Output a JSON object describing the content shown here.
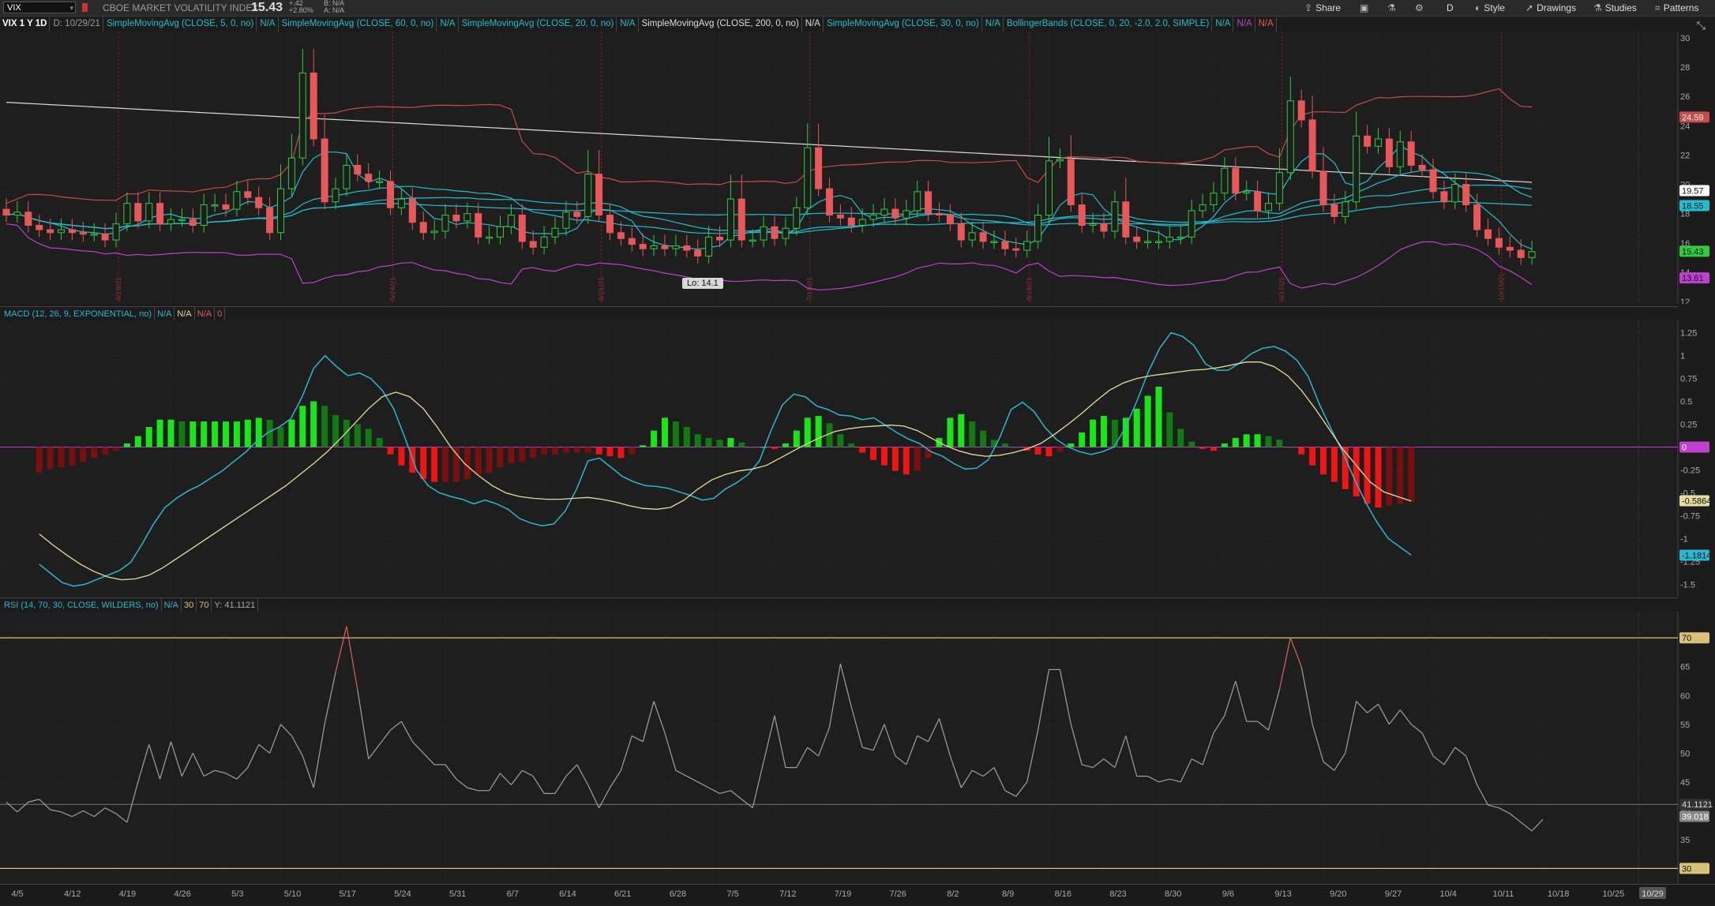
{
  "header": {
    "symbol": "VIX",
    "company": "CBOE MARKET VOLATILITY INDEX",
    "last": "15.43",
    "change": "+.42",
    "change_pct": "+2.80%",
    "bid": "B: N/A",
    "ask": "A: N/A",
    "buttons": {
      "share": "Share",
      "d": "D",
      "style": "Style",
      "drawings": "Drawings",
      "studies": "Studies",
      "patterns": "Patterns"
    }
  },
  "price_panel": {
    "title": "VIX 1 Y 1D",
    "date": "D: 10/29/21",
    "studies": [
      {
        "label": "SimpleMovingAvg (CLOSE, 5, 0, no)",
        "value": "N/A"
      },
      {
        "label": "SimpleMovingAvg (CLOSE, 60, 0, no)",
        "value": "N/A"
      },
      {
        "label": "SimpleMovingAvg (CLOSE, 20, 0, no)",
        "value": "N/A"
      },
      {
        "label": "SimpleMovingAvg (CLOSE, 200, 0, no)",
        "value": "N/A"
      },
      {
        "label": "SimpleMovingAvg (CLOSE, 30, 0, no)",
        "value": "N/A"
      },
      {
        "label": "BollingerBands (CLOSE, 0, 20, -2.0, 2.0, SIMPLE)",
        "value": "N/A",
        "value2": "N/A",
        "value3": "N/A"
      }
    ],
    "lo_label": "Lo: 14.1",
    "y_ticks": [
      "30",
      "28",
      "26",
      "24",
      "22",
      "20",
      "18",
      "16",
      "14",
      "12"
    ],
    "badges": [
      "24.59",
      "19.57",
      "18.55",
      "15.43",
      "13.61"
    ],
    "vlines": [
      "4/19/21",
      "5/24/21",
      "6/21/21",
      "7/19/21",
      "8/16/21",
      "9/17/21",
      "10/15/21"
    ]
  },
  "macd_panel": {
    "label": "MACD (12, 26, 9, EXPONENTIAL, no)",
    "v1": "N/A",
    "v2": "N/A",
    "v3": "N/A",
    "v4": "0",
    "y_ticks": [
      "1.25",
      "1",
      "0.75",
      "0.5",
      "0.25",
      "0",
      "-0.25",
      "-0.5",
      "-0.75",
      "-1",
      "-1.25",
      "-1.5"
    ],
    "badges": [
      "0",
      "-0.5864",
      "-1.1814"
    ]
  },
  "rsi_panel": {
    "label": "RSI (14, 70, 30, CLOSE, WILDERS, no)",
    "v1": "N/A",
    "ob": "30",
    "os": "70",
    "y": "Y: 41.1121",
    "y_ticks": [
      "70",
      "65",
      "60",
      "55",
      "50",
      "45",
      "40",
      "35",
      "30"
    ],
    "badges": [
      "70",
      "41.1121",
      "39.018",
      "30"
    ]
  },
  "x_axis": {
    "ticks": [
      "4/5",
      "4/12",
      "4/19",
      "4/26",
      "5/3",
      "5/10",
      "5/17",
      "5/24",
      "5/31",
      "6/7",
      "6/14",
      "6/21",
      "6/28",
      "7/5",
      "7/12",
      "7/19",
      "7/26",
      "8/2",
      "8/9",
      "8/16",
      "8/23",
      "8/30",
      "9/6",
      "9/13",
      "9/20",
      "9/27",
      "10/4",
      "10/11",
      "10/18",
      "10/25"
    ],
    "last_date_badge": "10/29"
  },
  "colors": {
    "up": "#2ecc40",
    "down": "#e8585a",
    "sma": "#1fbfcf",
    "sma200": "#dcdcdc",
    "bb_upper": "#c84a4a",
    "bb_lower": "#c040d0",
    "macd": "#2ab8d0",
    "signal": "#e6dca0",
    "rsi": "#a0a0a0",
    "rsi_ob": "#d8c27a",
    "rsi_over": "#e06060"
  },
  "chart_data": [
    {
      "type": "candlestick",
      "title": "VIX 1 Y 1D",
      "ylim": [
        12,
        30
      ],
      "x": [
        "4/5",
        "4/6",
        "4/7",
        "4/8",
        "4/9",
        "4/12",
        "4/13",
        "4/14",
        "4/15",
        "4/16",
        "4/19",
        "4/20",
        "4/21",
        "4/22",
        "4/23",
        "4/26",
        "4/27",
        "4/28",
        "4/29",
        "4/30",
        "5/3",
        "5/4",
        "5/5",
        "5/6",
        "5/7",
        "5/10",
        "5/11",
        "5/12",
        "5/13",
        "5/14",
        "5/17",
        "5/18",
        "5/19",
        "5/20",
        "5/21",
        "5/24",
        "5/25",
        "5/26",
        "5/27",
        "5/28",
        "6/1",
        "6/2",
        "6/3",
        "6/4",
        "6/7",
        "6/8",
        "6/9",
        "6/10",
        "6/11",
        "6/14",
        "6/15",
        "6/16",
        "6/17",
        "6/18",
        "6/21",
        "6/22",
        "6/23",
        "6/24",
        "6/25",
        "6/28",
        "6/29",
        "6/30",
        "7/1",
        "7/2",
        "7/6",
        "7/7",
        "7/8",
        "7/9",
        "7/12",
        "7/13",
        "7/14",
        "7/15",
        "7/16",
        "7/19",
        "7/20",
        "7/21",
        "7/22",
        "7/23",
        "7/26",
        "7/27",
        "7/28",
        "7/29",
        "7/30",
        "8/2",
        "8/3",
        "8/4",
        "8/5",
        "8/6",
        "8/9",
        "8/10",
        "8/11",
        "8/12",
        "8/13",
        "8/16",
        "8/17",
        "8/18",
        "8/19",
        "8/20",
        "8/23",
        "8/24",
        "8/25",
        "8/26",
        "8/27",
        "8/30",
        "8/31",
        "9/1",
        "9/2",
        "9/3",
        "9/7",
        "9/8",
        "9/9",
        "9/10",
        "9/13",
        "9/14",
        "9/15",
        "9/16",
        "9/17",
        "9/20",
        "9/21",
        "9/22",
        "9/23",
        "9/24",
        "9/27",
        "9/28",
        "9/29",
        "9/30",
        "10/1",
        "10/4",
        "10/5",
        "10/6",
        "10/7",
        "10/8",
        "10/11",
        "10/12",
        "10/13",
        "10/14",
        "10/15",
        "10/18",
        "10/19",
        "10/20",
        "10/21",
        "10/22"
      ],
      "close": [
        17.9,
        18.1,
        17.2,
        16.9,
        16.7,
        16.9,
        16.7,
        16.6,
        16.6,
        16.2,
        17.3,
        18.7,
        17.5,
        18.7,
        17.3,
        17.6,
        17.6,
        17.2,
        18.6,
        18.6,
        18.3,
        19.5,
        19.1,
        18.4,
        16.7,
        19.7,
        21.8,
        27.6,
        23.1,
        18.8,
        19.7,
        21.3,
        20.7,
        20.2,
        20.2,
        18.4,
        19.0,
        17.4,
        16.7,
        16.8,
        17.9,
        17.5,
        18.0,
        16.4,
        16.4,
        17.1,
        17.9,
        16.1,
        15.7,
        16.4,
        17.0,
        18.1,
        17.8,
        20.7,
        17.9,
        16.7,
        16.3,
        15.9,
        15.6,
        15.8,
        15.6,
        15.8,
        15.5,
        15.1,
        16.4,
        16.2,
        19.0,
        16.2,
        16.2,
        17.1,
        16.3,
        17.0,
        18.4,
        22.5,
        19.7,
        17.9,
        17.7,
        17.2,
        17.6,
        17.9,
        18.3,
        17.7,
        18.2,
        19.5,
        18.0,
        17.9,
        17.3,
        16.2,
        16.7,
        16.1,
        16.1,
        15.6,
        15.5,
        16.1,
        17.9,
        21.6,
        21.7,
        18.6,
        17.2,
        17.3,
        16.8,
        18.8,
        16.4,
        16.1,
        16.1,
        16.1,
        16.4,
        16.4,
        18.2,
        18.6,
        19.4,
        21.1,
        19.4,
        19.5,
        18.2,
        18.7,
        20.8,
        25.7,
        24.4,
        20.9,
        18.6,
        17.8,
        18.8,
        23.3,
        22.6,
        23.1,
        21.2,
        22.9,
        21.3,
        21.0,
        19.5,
        18.8,
        20.0,
        18.6,
        16.9,
        16.3,
        15.7,
        15.5,
        15.0,
        15.4
      ]
    },
    {
      "type": "line",
      "title": "MACD (12, 26, 9, EXPONENTIAL, no)",
      "ylim": [
        -1.6,
        1.35
      ],
      "series": [
        {
          "name": "MACD",
          "values": [
            -1.28,
            -1.38,
            -1.48,
            -1.52,
            -1.5,
            -1.45,
            -1.4,
            -1.35,
            -1.26,
            -1.06,
            -0.84,
            -0.66,
            -0.56,
            -0.48,
            -0.42,
            -0.34,
            -0.26,
            -0.16,
            -0.06,
            0.06,
            0.16,
            0.22,
            0.31,
            0.55,
            0.86,
            1.0,
            0.88,
            0.78,
            0.81,
            0.75,
            0.62,
            0.42,
            0.1,
            -0.25,
            -0.42,
            -0.5,
            -0.54,
            -0.57,
            -0.62,
            -0.58,
            -0.62,
            -0.68,
            -0.78,
            -0.83,
            -0.86,
            -0.84,
            -0.7,
            -0.46,
            -0.15,
            -0.12,
            -0.22,
            -0.32,
            -0.38,
            -0.42,
            -0.43,
            -0.45,
            -0.49,
            -0.53,
            -0.58,
            -0.56,
            -0.46,
            -0.39,
            -0.3,
            -0.15,
            0.18,
            0.46,
            0.58,
            0.55,
            0.45,
            0.41,
            0.35,
            0.34,
            0.3,
            0.32,
            0.24,
            0.16,
            0.09,
            0.04,
            -0.05,
            -0.1,
            -0.18,
            -0.24,
            -0.23,
            -0.14,
            0.1,
            0.41,
            0.49,
            0.39,
            0.21,
            0.08,
            0.0,
            -0.05,
            -0.08,
            -0.05,
            0.0,
            0.21,
            0.5,
            0.82,
            1.08,
            1.25,
            1.21,
            1.11,
            0.91,
            0.84,
            0.84,
            0.92,
            1.02,
            1.08,
            1.1,
            1.05,
            0.95,
            0.77,
            0.46,
            0.2,
            -0.05,
            -0.34,
            -0.6,
            -0.82,
            -1.0,
            -1.09,
            -1.18
          ]
        },
        {
          "name": "Signal",
          "values": [
            -0.95,
            -1.07,
            -1.18,
            -1.28,
            -1.36,
            -1.42,
            -1.45,
            -1.44,
            -1.4,
            -1.32,
            -1.22,
            -1.12,
            -1.02,
            -0.92,
            -0.82,
            -0.72,
            -0.62,
            -0.52,
            -0.42,
            -0.3,
            -0.18,
            -0.05,
            0.1,
            0.26,
            0.42,
            0.55,
            0.6,
            0.55,
            0.42,
            0.22,
            0.0,
            -0.18,
            -0.31,
            -0.42,
            -0.5,
            -0.54,
            -0.56,
            -0.57,
            -0.57,
            -0.56,
            -0.55,
            -0.57,
            -0.6,
            -0.64,
            -0.67,
            -0.68,
            -0.66,
            -0.58,
            -0.46,
            -0.36,
            -0.3,
            -0.26,
            -0.24,
            -0.2,
            -0.12,
            -0.04,
            0.04,
            0.11,
            0.17,
            0.2,
            0.22,
            0.23,
            0.24,
            0.23,
            0.18,
            0.1,
            0.02,
            -0.04,
            -0.08,
            -0.1,
            -0.09,
            -0.06,
            -0.02,
            0.04,
            0.14,
            0.25,
            0.37,
            0.5,
            0.62,
            0.7,
            0.75,
            0.78,
            0.8,
            0.82,
            0.84,
            0.85,
            0.87,
            0.9,
            0.93,
            0.93,
            0.88,
            0.78,
            0.62,
            0.42,
            0.2,
            -0.02,
            -0.2,
            -0.38,
            -0.49,
            -0.54,
            -0.59
          ]
        },
        {
          "name": "Histogram",
          "values": [
            -0.28,
            -0.24,
            -0.22,
            -0.2,
            -0.16,
            -0.12,
            -0.08,
            -0.04,
            0.04,
            0.12,
            0.22,
            0.3,
            0.3,
            0.28,
            0.28,
            0.28,
            0.28,
            0.28,
            0.28,
            0.3,
            0.32,
            0.3,
            0.22,
            0.3,
            0.45,
            0.5,
            0.45,
            0.35,
            0.3,
            0.25,
            0.2,
            0.1,
            -0.08,
            -0.2,
            -0.28,
            -0.35,
            -0.38,
            -0.38,
            -0.38,
            -0.35,
            -0.3,
            -0.28,
            -0.22,
            -0.18,
            -0.16,
            -0.12,
            -0.08,
            -0.08,
            -0.06,
            -0.06,
            -0.06,
            -0.08,
            -0.1,
            -0.12,
            -0.08,
            0.02,
            0.18,
            0.32,
            0.28,
            0.22,
            0.14,
            0.1,
            0.08,
            0.1,
            0.05,
            0.0,
            0.0,
            -0.02,
            0.04,
            0.18,
            0.32,
            0.34,
            0.26,
            0.14,
            0.04,
            -0.06,
            -0.14,
            -0.2,
            -0.26,
            -0.3,
            -0.26,
            -0.12,
            0.1,
            0.32,
            0.36,
            0.28,
            0.18,
            0.08,
            0.04,
            0.0,
            -0.04,
            -0.08,
            -0.1,
            -0.05,
            0.04,
            0.16,
            0.3,
            0.34,
            0.3,
            0.32,
            0.42,
            0.56,
            0.66,
            0.38,
            0.2,
            0.06,
            -0.02,
            -0.04,
            0.04,
            0.1,
            0.14,
            0.14,
            0.12,
            0.08,
            0.0,
            -0.08,
            -0.2,
            -0.3,
            -0.38,
            -0.46,
            -0.54,
            -0.62,
            -0.66,
            -0.64,
            -0.62,
            -0.6
          ]
        }
      ]
    },
    {
      "type": "line",
      "title": "RSI (14, 70, 30, CLOSE, WILDERS, no)",
      "ylim": [
        28,
        74
      ],
      "series": [
        {
          "name": "RSI",
          "values": [
            41.5,
            39.8,
            41.5,
            42.0,
            40.2,
            39.8,
            39.0,
            40.0,
            39.0,
            40.5,
            39.5,
            38.0,
            45.0,
            51.5,
            45.5,
            52.0,
            46.0,
            50.0,
            46.0,
            47.0,
            46.5,
            45.5,
            47.5,
            51.5,
            50.0,
            55.0,
            53.0,
            49.5,
            44.0,
            55.0,
            64.0,
            72.0,
            61.0,
            49.0,
            51.5,
            54.0,
            55.5,
            52.0,
            50.0,
            48.0,
            48.0,
            45.5,
            44.0,
            43.5,
            43.5,
            46.5,
            44.5,
            47.0,
            46.0,
            43.0,
            43.0,
            46.0,
            48.0,
            44.5,
            40.5,
            44.0,
            47.0,
            53.0,
            52.0,
            59.0,
            53.5,
            47.0,
            46.0,
            45.0,
            44.0,
            43.0,
            43.5,
            42.0,
            40.5,
            48.5,
            56.5,
            47.5,
            47.5,
            51.0,
            49.5,
            54.5,
            65.5,
            58.0,
            51.0,
            50.5,
            55.0,
            49.5,
            48.0,
            53.0,
            52.0,
            56.0,
            49.5,
            44.0,
            47.0,
            46.0,
            47.5,
            43.5,
            42.5,
            45.0,
            54.0,
            64.5,
            64.5,
            55.0,
            48.0,
            47.5,
            49.0,
            47.5,
            53.0,
            46.0,
            46.0,
            45.0,
            45.5,
            45.0,
            49.0,
            48.0,
            53.5,
            56.5,
            62.5,
            55.5,
            55.5,
            54.0,
            61.0,
            70.0,
            65.0,
            55.0,
            48.5,
            47.0,
            50.0,
            59.0,
            57.0,
            58.5,
            55.0,
            57.5,
            55.0,
            53.5,
            49.5,
            48.0,
            51.0,
            49.5,
            44.5,
            41.0,
            40.5,
            39.5,
            38.0,
            36.5,
            38.5
          ]
        }
      ]
    }
  ]
}
